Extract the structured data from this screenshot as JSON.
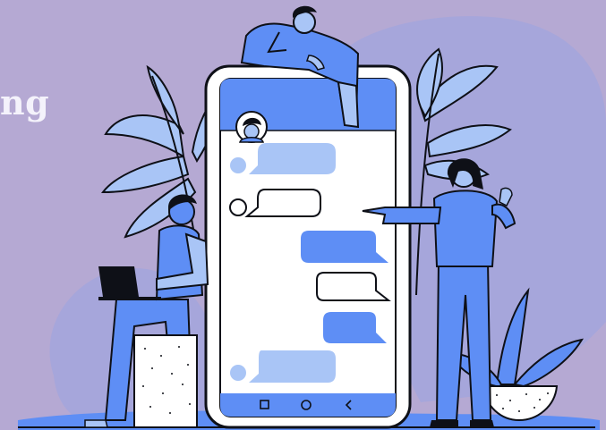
{
  "page": {
    "heading_fragment": "ng"
  },
  "colors": {
    "background": "#b5a9d3",
    "blob": "#a6a6db",
    "accent_blue": "#5e8ef5",
    "light_blue": "#a9c5f6",
    "outline": "#0e1017",
    "white": "#ffffff",
    "heading": "#f4f2fb"
  },
  "phone": {
    "nav_icons": [
      "square-icon",
      "circle-icon",
      "back-chevron-icon"
    ]
  },
  "chat": {
    "messages": [
      {
        "side": "left",
        "style": "filled-light",
        "avatar": true
      },
      {
        "side": "left",
        "style": "outlined",
        "avatar": true
      },
      {
        "side": "right",
        "style": "filled-blue",
        "avatar": false
      },
      {
        "side": "right",
        "style": "outlined",
        "avatar": false
      },
      {
        "side": "right",
        "style": "filled-blue",
        "avatar": false
      },
      {
        "side": "left",
        "style": "filled-light",
        "avatar": true
      }
    ]
  }
}
